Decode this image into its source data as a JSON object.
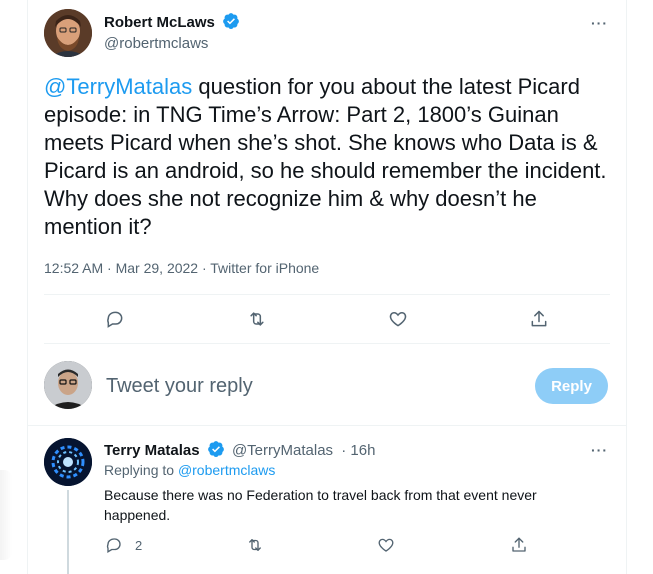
{
  "main_tweet": {
    "author_name": "Robert McLaws",
    "author_handle": "@robertmclaws",
    "mention": "@TerryMatalas",
    "text": " question for you about the latest Picard episode: in TNG Time’s Arrow: Part 2, 1800’s Guinan meets Picard when she’s shot. She knows who Data is & Picard is an android, so he should remember the incident. Why does she not recognize him & why doesn’t he mention it?",
    "meta": "12:52 AM · Mar 29, 2022 · Twitter for iPhone",
    "more_label": "···"
  },
  "compose": {
    "placeholder": "Tweet your reply",
    "reply_button": "Reply"
  },
  "reply_tweet": {
    "author_name": "Terry Matalas",
    "author_handle": "@TerryMatalas",
    "time": "· 16h",
    "replying_prefix": "Replying to ",
    "replying_to": "@robertmclaws",
    "text": "Because there was no Federation to travel back from that event never happened.",
    "reply_count": "2",
    "more_label": "···"
  },
  "colors": {
    "accent": "#1d9bf0",
    "verified": "#1d9bf0",
    "muted": "#536471",
    "reply_button_disabled": "#8ecdf7"
  },
  "icons": [
    "verified-badge-icon",
    "more-icon",
    "reply-icon",
    "retweet-icon",
    "like-icon",
    "share-icon"
  ]
}
